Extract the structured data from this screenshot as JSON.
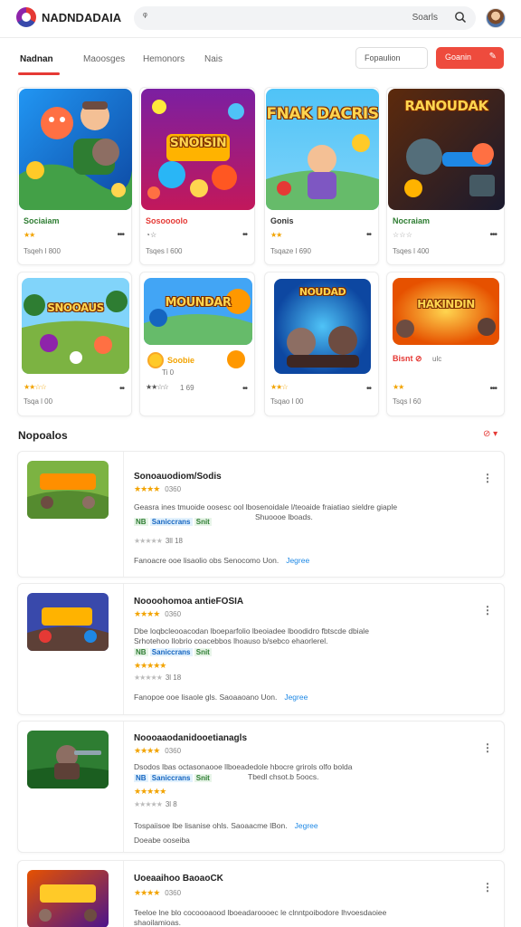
{
  "header": {
    "brand": "NADNDADAIA",
    "search_lead": "ᵠ",
    "search_text": "Soarls",
    "search_icon": "search-icon",
    "avatar": "user-avatar"
  },
  "tabs": {
    "items": [
      {
        "label": "Nadnan",
        "active": true
      },
      {
        "label": "Maoosges",
        "active": false
      },
      {
        "label": "Hemonors",
        "active": false
      },
      {
        "label": "Nais",
        "active": false
      }
    ],
    "filter_label": "Fopaulion",
    "primary_label": "Goanin",
    "primary_icon": "edit-icon"
  },
  "grid": [
    {
      "title": "Sociaiam",
      "title_color": "#2e7d32",
      "stars": "★★",
      "meta": "Tsqeh l 800",
      "more": "•••"
    },
    {
      "title": "Sosoooolo",
      "title_color": "#e53935",
      "stars": "◔ ☆",
      "meta": "Tsqes l 600",
      "more": "••"
    },
    {
      "title": "Gonis",
      "title_color": "#333333",
      "stars": "★★",
      "meta": "Tsqaze l 690",
      "more": "••"
    },
    {
      "title": "Nocraiam",
      "title_color": "#2e7d32",
      "stars": "☆ ☆ ☆",
      "meta": "Tsqes l 400",
      "more": "•••"
    },
    {
      "title": "",
      "title_color": "#333333",
      "stars": "★★☆☆",
      "meta": "Tsqa l 00",
      "more": "••"
    },
    {
      "title": "Soobie",
      "title_color": "#f2a300",
      "stars": "★★☆☆",
      "meta": "1 69",
      "sub": "Ti 0",
      "more": "••"
    },
    {
      "title": "",
      "title_color": "#333333",
      "stars": "★★☆",
      "meta": "Tsqao l 00",
      "more": "••"
    },
    {
      "title": "Bisnt ⊘",
      "title_color": "#e53935",
      "stars": "★★",
      "meta": "Tsqs l 60",
      "sub": "ulc",
      "more": "•••"
    }
  ],
  "thumb_labels": [
    "",
    "SNOISIN",
    "FNAK DACRIS",
    "RANOUDAK",
    "SNOOAUS",
    "MOUNDAR",
    "NOUDAD",
    "HAKINDIN"
  ],
  "section": {
    "title": "Nopoalos",
    "link_icon": "chevron-down-icon"
  },
  "list": [
    {
      "title": "Sonoauodiom/Sodis",
      "stars": "★★★★",
      "count": "0360",
      "desc": "Geasra ines tmuoide oosesc ool lbosenoidale l/teoaide fraiatiao sieldre giaple",
      "desc2": "Shuoooe lboads.",
      "tags": [
        "NB",
        "Saniccrans",
        "Snit"
      ],
      "gray": "★★★★★",
      "gray_num": "3ll 18",
      "footer": "Fanoacre ooe lisaolio obs  Senocomo  Uon.",
      "more": "Jegree"
    },
    {
      "title": "Noooohomoa antieFOSIA",
      "stars": "★★★★",
      "count": "0360",
      "desc": "Dbe loqbcleooacodan lboeparfolio lbeoiadee lboodidro fbtscde dbiale",
      "desc2": "Srhotehoo llobrio coacebbos lhoauso b/sebco ehaorlerel.",
      "tags": [
        "NB",
        "Saniccrans",
        "Snit"
      ],
      "stars2": "★★★★★",
      "gray": "★★★★★",
      "gray_num": "3l 18",
      "footer": "Fanopoe ooe lisaole gls.  Saoaaoano  Uon.",
      "more": "Jegree"
    },
    {
      "title": "Noooaaodanidooetianagls",
      "stars": "★★★★",
      "count": "0360",
      "desc": "Dsodos lbas octasonaooe llboeadedole hbocre grirols olfo bolda",
      "desc2": "Tbedl chsot.b 5oocs.",
      "tags": [
        "NB",
        "Saniccrans",
        "Snit"
      ],
      "stars2": "★★★★★",
      "gray": "★★★★★",
      "gray_num": "3l 8",
      "footer": "Tospaiisoe lbe lisanise ohls. Saoaacme lBon.",
      "more": "Jegree",
      "sub": "Doeabe ooseiba"
    },
    {
      "title": "Uoeaaihoo BaoaoCK",
      "stars": "★★★★",
      "count": "0360",
      "desc": "Teeloe lne blo cocoooaood lboeadaroooec le clnntpoibodore lhvoesdaoiee",
      "desc2": "shaoilamioas.",
      "tags": [],
      "gray": "",
      "gray_num": "",
      "footer": "",
      "more": ""
    }
  ],
  "colors": {
    "accent": "#e53935",
    "link": "#1e88e5",
    "star": "#f2a300"
  }
}
